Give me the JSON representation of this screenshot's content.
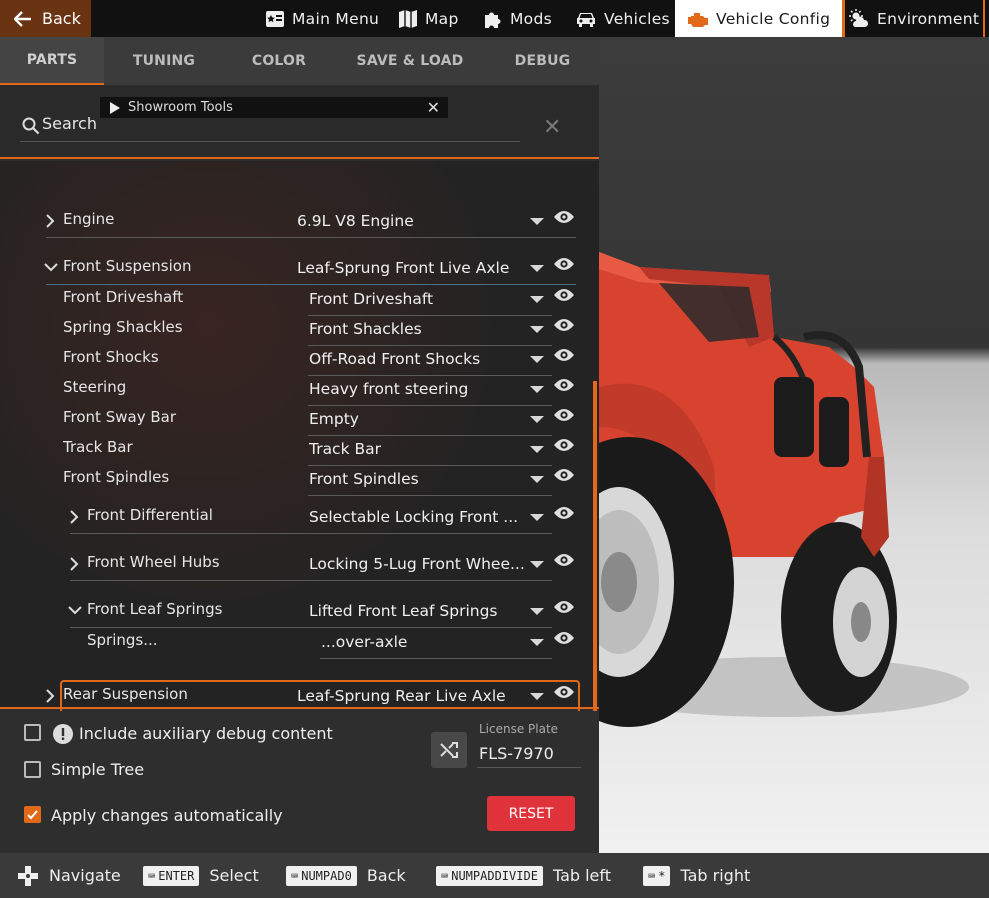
{
  "topbar": {
    "back_label": "Back",
    "items": [
      {
        "label": "Main Menu",
        "icon": "main-menu-icon"
      },
      {
        "label": "Map",
        "icon": "map-icon"
      },
      {
        "label": "Mods",
        "icon": "puzzle-icon"
      },
      {
        "label": "Vehicles",
        "icon": "car-icon"
      },
      {
        "label": "Vehicle Config",
        "icon": "engine-icon",
        "active": true
      },
      {
        "label": "Environment",
        "icon": "weather-icon"
      }
    ]
  },
  "tabs": [
    "PARTS",
    "TUNING",
    "COLOR",
    "SAVE & LOAD",
    "DEBUG"
  ],
  "search": {
    "label": "Search",
    "showroom_label": "Showroom Tools"
  },
  "tree": [
    {
      "name": "Engine",
      "value": "6.9L V8 Engine"
    },
    {
      "name": "Front Suspension",
      "value": "Leaf-Sprung Front Live Axle"
    },
    {
      "name": "Front Driveshaft",
      "value": "Front Driveshaft"
    },
    {
      "name": "Spring Shackles",
      "value": "Front Shackles"
    },
    {
      "name": "Front Shocks",
      "value": "Off-Road Front Shocks"
    },
    {
      "name": "Steering",
      "value": "Heavy front steering"
    },
    {
      "name": "Front Sway Bar",
      "value": "Empty"
    },
    {
      "name": "Track Bar",
      "value": "Track Bar"
    },
    {
      "name": "Front Spindles",
      "value": "Front Spindles"
    },
    {
      "name": "Front Differential",
      "value": "Selectable Locking Front ..."
    },
    {
      "name": "Front Wheel Hubs",
      "value": "Locking 5-Lug Front Whee..."
    },
    {
      "name": "Front Leaf Springs",
      "value": "Lifted Front Leaf Springs"
    },
    {
      "name": "Springs...",
      "value": "...over-axle"
    },
    {
      "name": "Rear Suspension",
      "value": "Leaf-Sprung Rear Live Axle"
    }
  ],
  "options": {
    "debug_label": "Include auxiliary debug content",
    "simple_tree_label": "Simple Tree",
    "apply_label": "Apply changes automatically",
    "apply_checked": true,
    "plate_label": "License Plate",
    "plate_value": "FLS-7970",
    "reset_label": "RESET"
  },
  "footer": [
    {
      "key": "",
      "label": "Navigate",
      "icon": "dpad-icon"
    },
    {
      "key": "ENTER",
      "label": "Select"
    },
    {
      "key": "NUMPAD0",
      "label": "Back"
    },
    {
      "key": "NUMPADDIVIDE",
      "label": "Tab left"
    },
    {
      "key": "*",
      "label": "Tab right"
    }
  ],
  "colors": {
    "accent": "#e06a1a",
    "reset": "#e0323b",
    "vehicle": "#e0473a"
  }
}
